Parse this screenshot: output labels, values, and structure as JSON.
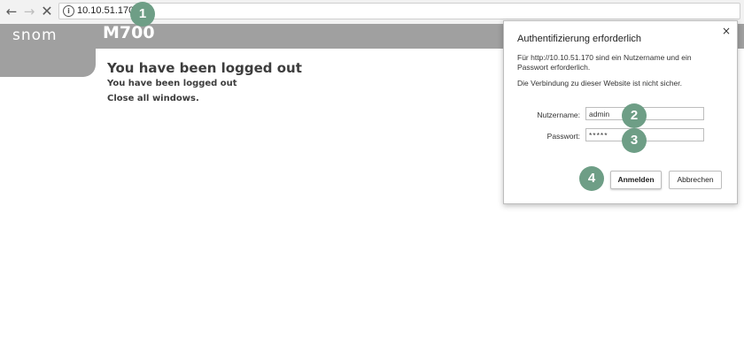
{
  "browser": {
    "url": "10.10.51.170",
    "back_glyph": "←",
    "forward_glyph": "→",
    "stop_glyph": "✕",
    "info_glyph": "i"
  },
  "page": {
    "logo": "snom",
    "model": "M700",
    "heading": "You have been logged out",
    "subheading": "You have been logged out",
    "close_text": "Close all windows."
  },
  "dialog": {
    "title": "Authentifizierung erforderlich",
    "close_glyph": "×",
    "description": "Für http://10.10.51.170 sind ein Nutzername und ein Passwort erforderlich.",
    "warning": "Die Verbindung zu dieser Website ist nicht sicher.",
    "username_label": "Nutzername:",
    "username_value": "admin",
    "password_label": "Passwort:",
    "password_value": "*****",
    "login_button": "Anmelden",
    "cancel_button": "Abbrechen"
  },
  "callouts": [
    "1",
    "2",
    "3",
    "4"
  ],
  "colors": {
    "header": "#a0a0a0",
    "callout": "#6e9e86"
  }
}
